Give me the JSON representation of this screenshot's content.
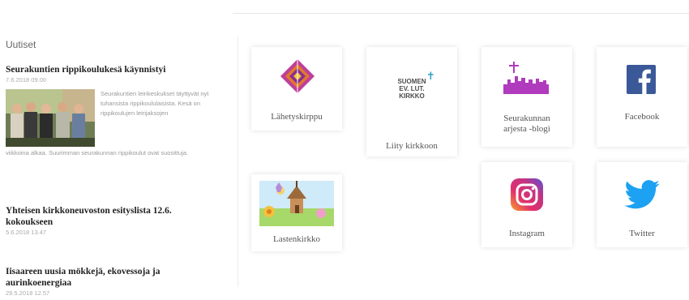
{
  "news": {
    "heading": "Uutiset",
    "items": [
      {
        "title": "Seurakuntien rippikoulukesä käynnistyi",
        "date": "7.6.2018 09.00",
        "excerpt_side": "Seurakuntien leirikeskukset täyttyvät nyt tuhansista rippikoululaisista. Kesä on rippikoulujen leirijaksojen",
        "excerpt_cont": "viikkoina alkaa. Suurimman seurakunnan rippikoulut ovat suosittuja."
      },
      {
        "title": "Yhteisen kirkkoneuvoston esityslista 12.6. kokoukseen",
        "date": "5.6.2018 13.47"
      },
      {
        "title": "Iisaareen uusia mökkejä, ekovessoja ja aurinkoenergiaa",
        "date": "29.5.2018 12.57"
      }
    ]
  },
  "tiles": {
    "lahetys": "Lähetyskirppu",
    "kirkko_brand": [
      "SUOMEN",
      "EV. LUT.",
      "KIRKKO"
    ],
    "kirkko": "Liity kirkkoon",
    "blogi": [
      "Seurakunnan",
      "arjesta -blogi"
    ],
    "facebook": "Facebook",
    "lastenkirkko": "Lastenkirkko",
    "instagram": "Instagram",
    "twitter": "Twitter"
  },
  "colors": {
    "facebook": "#3b5998",
    "twitter": "#1da1f2",
    "purple": "#b03bbd",
    "kirkko_cross": "#2aa2c9"
  },
  "icons": [
    "lahetys-mosaic-icon",
    "church-cross-icon",
    "blog-skyline-icon",
    "facebook-icon",
    "lastenkirkko-drawing-icon",
    "instagram-icon",
    "twitter-icon"
  ]
}
